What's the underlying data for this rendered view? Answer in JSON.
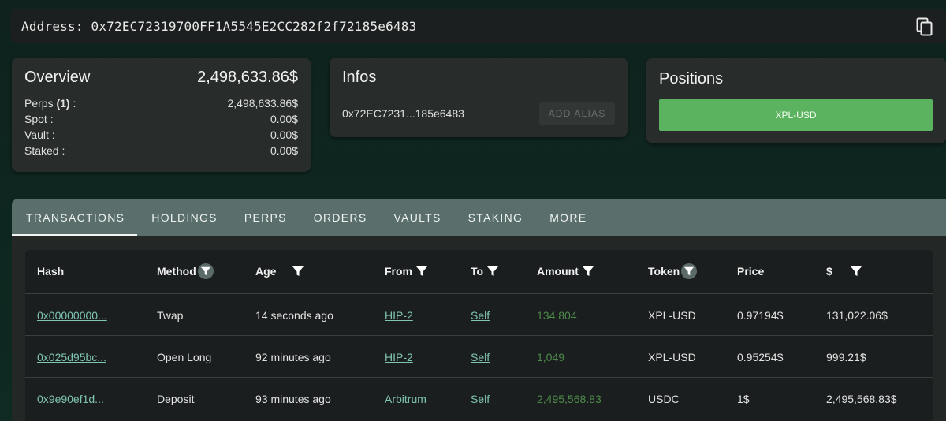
{
  "address_bar": {
    "label": "Address: 0x72EC72319700FF1A5545E2CC282f2f72185e6483",
    "copy_icon": "copy-icon"
  },
  "overview": {
    "title": "Overview",
    "total": "2,498,633.86$",
    "rows": [
      {
        "label_prefix": "Perps ",
        "label_bold": "(1)",
        "label_suffix": " :",
        "value": "2,498,633.86$"
      },
      {
        "label_prefix": "Spot :",
        "label_bold": "",
        "label_suffix": "",
        "value": "0.00$"
      },
      {
        "label_prefix": "Vault :",
        "label_bold": "",
        "label_suffix": "",
        "value": "0.00$"
      },
      {
        "label_prefix": "Staked :",
        "label_bold": "",
        "label_suffix": "",
        "value": "0.00$"
      }
    ]
  },
  "infos": {
    "title": "Infos",
    "short_address": "0x72EC7231...185e6483",
    "alias_button": "ADD ALIAS"
  },
  "positions": {
    "title": "Positions",
    "items": [
      "XPL-USD"
    ],
    "item_color": "#5cb35f"
  },
  "tabs": [
    {
      "label": "TRANSACTIONS",
      "active": true
    },
    {
      "label": "HOLDINGS",
      "active": false
    },
    {
      "label": "PERPS",
      "active": false
    },
    {
      "label": "ORDERS",
      "active": false
    },
    {
      "label": "VAULTS",
      "active": false
    },
    {
      "label": "STAKING",
      "active": false
    },
    {
      "label": "MORE",
      "active": false
    }
  ],
  "table": {
    "columns": [
      "Hash",
      "Method",
      "Age",
      "From",
      "To",
      "Amount",
      "Token",
      "Price",
      "$"
    ],
    "rows": [
      {
        "hash": "0x00000000...",
        "method": "Twap",
        "age": "14 seconds ago",
        "from": "HIP-2",
        "to": "Self",
        "amount": "134,804",
        "token": "XPL-USD",
        "price": "0.97194$",
        "usd": "131,022.06$"
      },
      {
        "hash": "0x025d95bc...",
        "method": "Open Long",
        "age": "92 minutes ago",
        "from": "HIP-2",
        "to": "Self",
        "amount": "1,049",
        "token": "XPL-USD",
        "price": "0.95254$",
        "usd": "999.21$"
      },
      {
        "hash": "0x9e90ef1d...",
        "method": "Deposit",
        "age": "93 minutes ago",
        "from": "Arbitrum",
        "to": "Self",
        "amount": "2,495,568.83",
        "token": "USDC",
        "price": "1$",
        "usd": "2,495,568.83$"
      }
    ],
    "amount_color": "#4d8a4a",
    "link_color": "#7fc5b4"
  }
}
